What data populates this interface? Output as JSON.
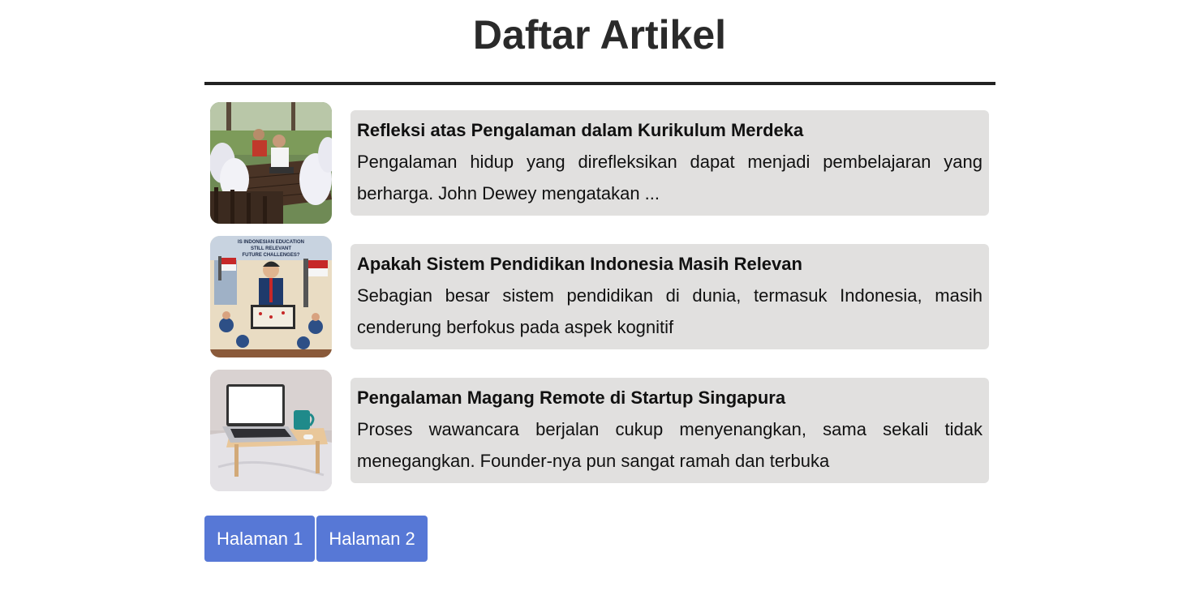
{
  "page": {
    "title": "Daftar Artikel"
  },
  "articles": [
    {
      "title": "Refleksi atas Pengalaman dalam Kurikulum Merdeka",
      "excerpt": "Pengalaman hidup yang direfleksikan dapat menjadi pembelajaran yang berharga. John Dewey mengatakan ...",
      "image": "students-outdoor-discussion-photo"
    },
    {
      "title": "Apakah Sistem Pendidikan Indonesia Masih Relevan",
      "excerpt": "Sebagian besar sistem pendidikan di dunia, termasuk Indonesia, masih cenderung berfokus pada aspek kognitif",
      "image": "education-illustration-poster",
      "image_text": "IS INDONESIAN EDUCATION STILL RELEVANT FUTURE CHALLENGES?"
    },
    {
      "title": "Pengalaman Magang Remote di Startup Singapura",
      "excerpt": "Proses wawancara berjalan cukup menyenangkan, sama sekali tidak menegangkan. Founder-nya pun sangat ramah dan terbuka",
      "image": "laptop-on-bed-tray-photo"
    }
  ],
  "pagination": {
    "pages": [
      "Halaman 1",
      "Halaman 2"
    ]
  },
  "colors": {
    "card_bg": "#e1e0df",
    "button_bg": "#5778d6",
    "rule": "#222222"
  }
}
